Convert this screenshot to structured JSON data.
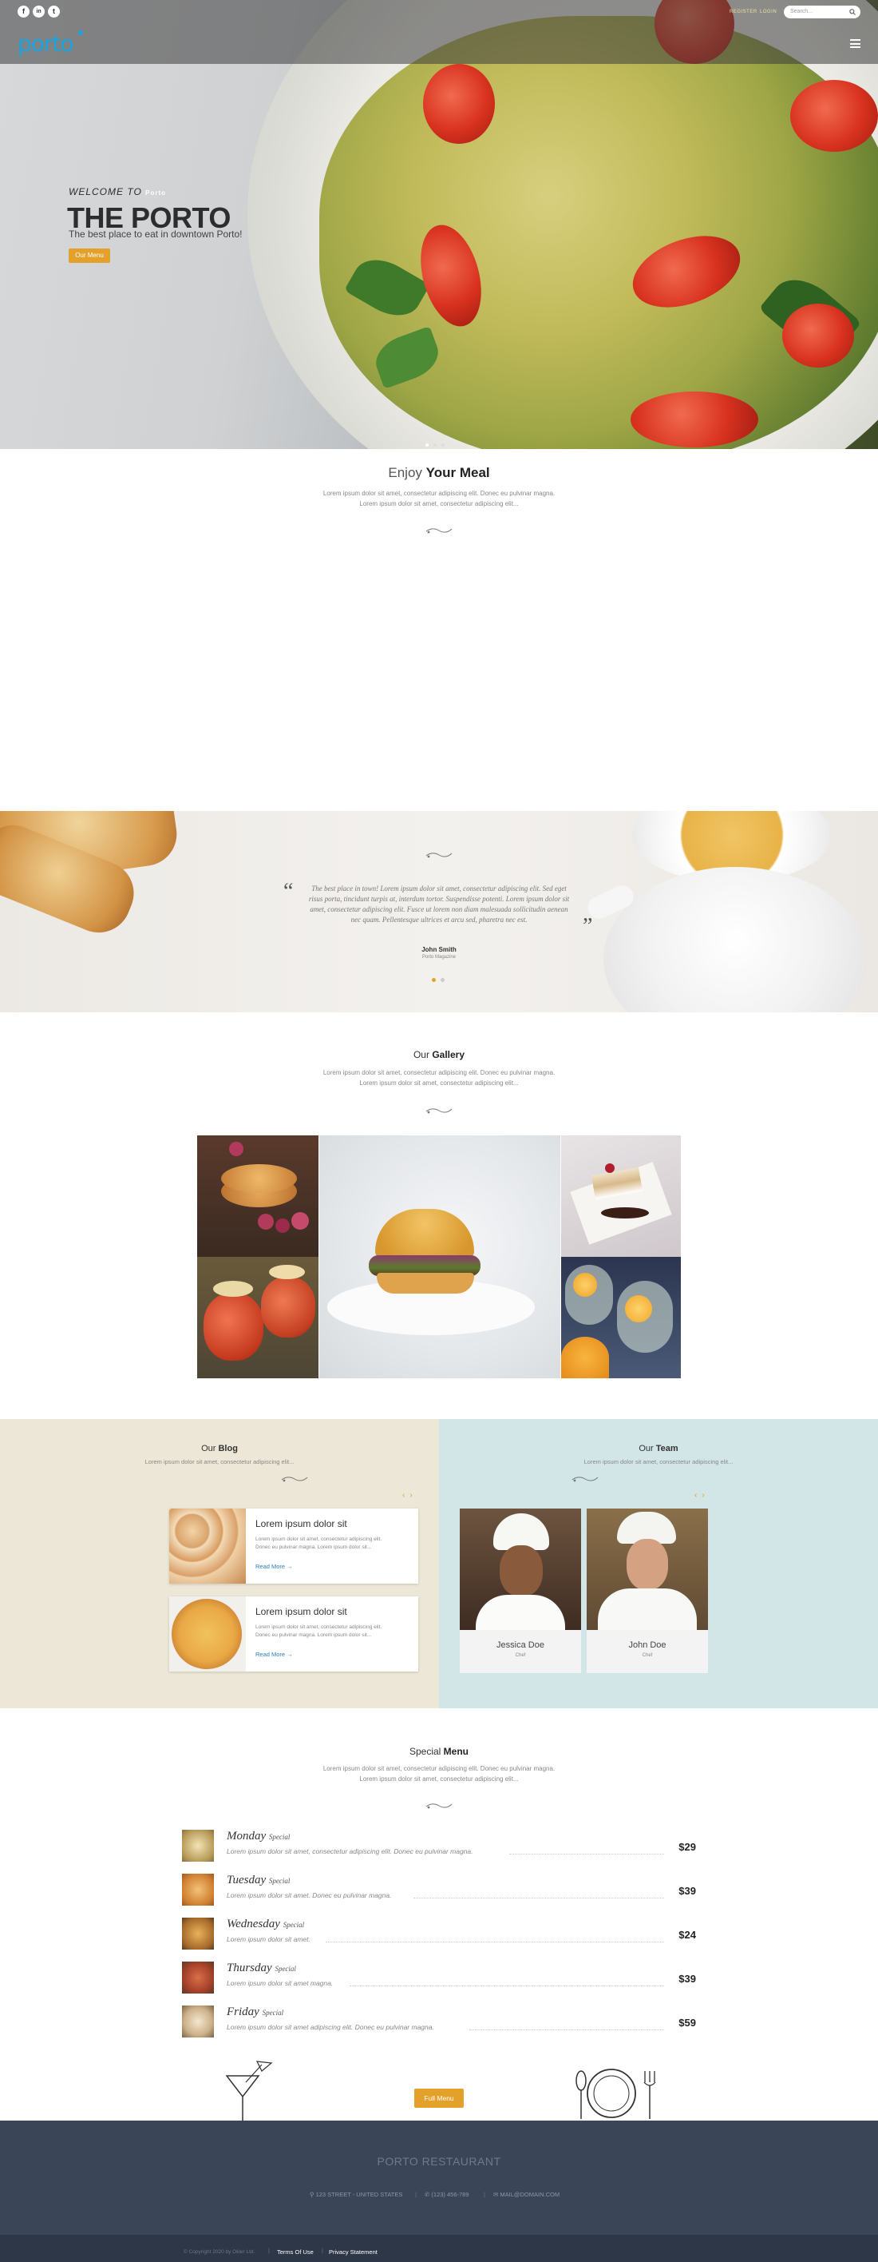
{
  "topbar": {
    "social": [
      "f",
      "in",
      "t"
    ],
    "links": [
      "REGISTER",
      "LOGIN"
    ],
    "search_placeholder": "Search...",
    "logo": "porto"
  },
  "hero": {
    "welcome": "WELCOME TO",
    "welcome_small": "Porto",
    "title": "THE PORTO",
    "subtitle": "The best place to eat in downtown Porto!",
    "button": "Our Menu"
  },
  "enjoy": {
    "title_light": "Enjoy",
    "title_bold": "Your Meal",
    "text1": "Lorem ipsum dolor sit amet, consectetur adipiscing elit. Donec eu pulvinar magna.",
    "text2": "Lorem ipsum dolor sit amet, consectetur adipiscing elit..."
  },
  "testimonial": {
    "quote": "The best place in town! Lorem ipsum dolor sit amet, consectetur adipiscing elit. Sed eget risus porta, tincidunt turpis at, interdum tortor. Suspendisse potenti. Lorem ipsum dolor sit amet, consectetur adipiscing elit. Fusce ut lorem non diam malesuada sollicitudin aenean nec quam. Pellentesque ultrices et arcu sed, pharetra nec est.",
    "author": "John Smith",
    "source": "Porto Magazine"
  },
  "gallery": {
    "title_light": "Our",
    "title_bold": "Gallery",
    "text1": "Lorem ipsum dolor sit amet, consectetur adipiscing elit. Donec eu pulvinar magna.",
    "text2": "Lorem ipsum dolor sit amet, consectetur adipiscing elit..."
  },
  "blog": {
    "title_light": "Our",
    "title_bold": "Blog",
    "text": "Lorem ipsum dolor sit amet, consectetur adipiscing elit...",
    "posts": [
      {
        "title": "Lorem ipsum dolor sit",
        "text": "Lorem ipsum dolor sit amet, consectetur adipiscing elit. Donec eu pulvinar magna. Lorem ipsum dolor sit...",
        "link": "Read More →"
      },
      {
        "title": "Lorem ipsum dolor sit",
        "text": "Lorem ipsum dolor sit amet, consectetur adipiscing elit. Donec eu pulvinar magna. Lorem ipsum dolor sit...",
        "link": "Read More →"
      }
    ]
  },
  "team": {
    "title_light": "Our",
    "title_bold": "Team",
    "text": "Lorem ipsum dolor sit amet, consectetur adipiscing elit...",
    "members": [
      {
        "name": "Jessica Doe",
        "role": "Chef"
      },
      {
        "name": "John Doe",
        "role": "Chef"
      }
    ]
  },
  "special": {
    "title_light": "Special",
    "title_bold": "Menu",
    "text1": "Lorem ipsum dolor sit amet, consectetur adipiscing elit. Donec eu pulvinar magna.",
    "text2": "Lorem ipsum dolor sit amet, consectetur adipiscing elit...",
    "items": [
      {
        "day": "Monday",
        "tag": "Special",
        "desc": "Lorem ipsum dolor sit amet, consectetur adipiscing elit. Donec eu pulvinar magna.",
        "price": "$29"
      },
      {
        "day": "Tuesday",
        "tag": "Special",
        "desc": "Lorem ipsum dolor sit amet. Donec eu pulvinar magna.",
        "price": "$39"
      },
      {
        "day": "Wednesday",
        "tag": "Special",
        "desc": "Lorem ipsum dolor sit amet.",
        "price": "$24"
      },
      {
        "day": "Thursday",
        "tag": "Special",
        "desc": "Lorem ipsum dolor sit amet magna.",
        "price": "$39"
      },
      {
        "day": "Friday",
        "tag": "Special",
        "desc": "Lorem ipsum dolor sit amet adipiscing elit. Donec eu pulvinar magna.",
        "price": "$59"
      }
    ],
    "button": "Full Menu"
  },
  "footer": {
    "name": "PORTO RESTAURANT",
    "address": "123 STREET - UNITED STATES",
    "phone": "(123) 456-789",
    "email": "MAIL@DOMAIN.COM",
    "copyright": "© Copyright 2020 by Okler Ltd.",
    "terms": "Terms Of Use",
    "privacy": "Privacy Statement"
  },
  "colors": {
    "accent": "#e3a12b",
    "blog_bg": "#ece7d6",
    "team_bg": "#d2e5e7",
    "footer_bg": "#3a4558"
  }
}
